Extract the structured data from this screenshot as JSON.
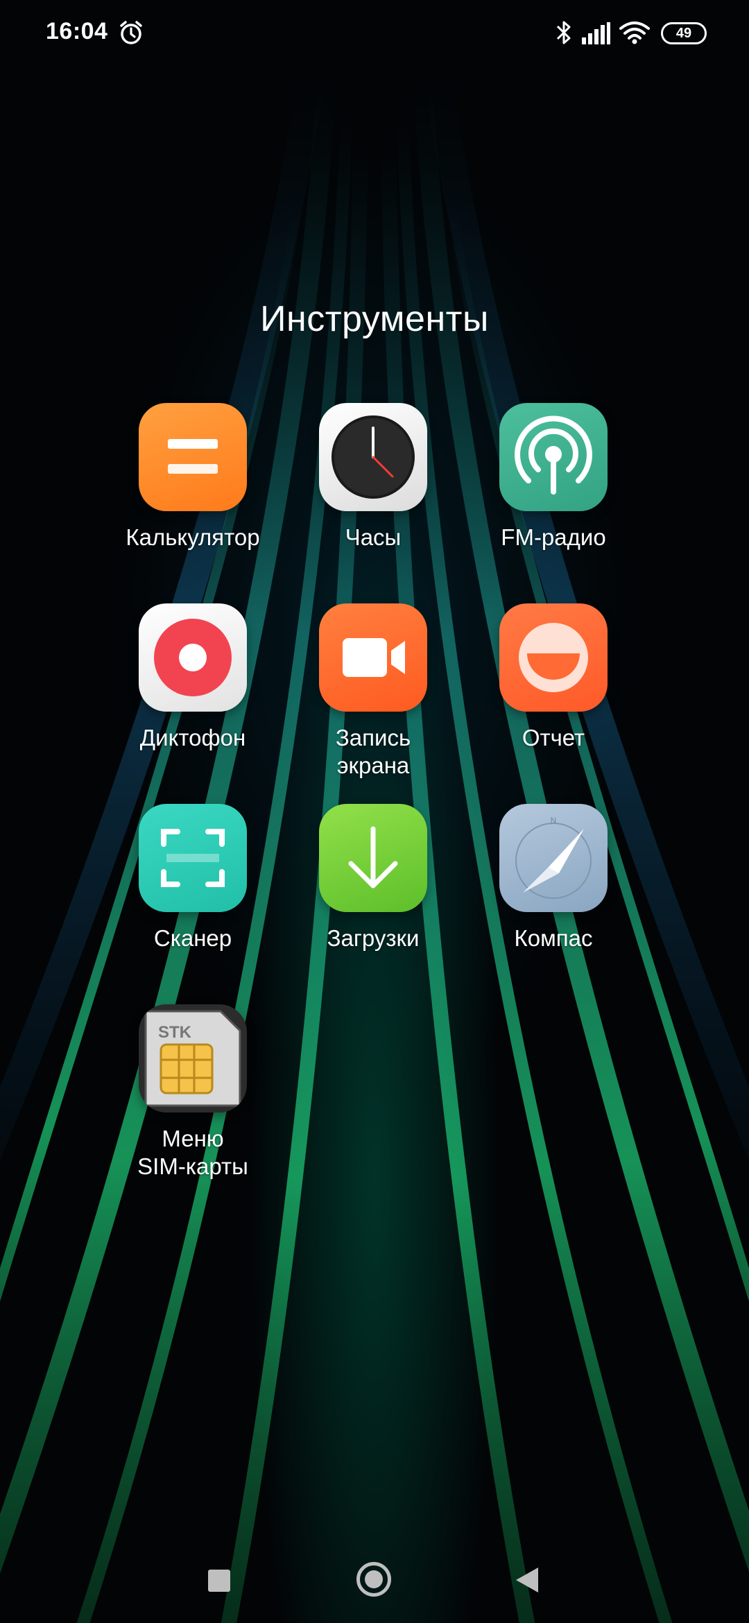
{
  "status_bar": {
    "time": "16:04",
    "battery_level": "49",
    "icons": [
      "alarm-icon",
      "bluetooth-icon",
      "signal-icon",
      "wifi-icon",
      "battery-icon"
    ]
  },
  "folder": {
    "title": "Инструменты",
    "apps": [
      {
        "label": "Калькулятор",
        "icon": "calculator-icon",
        "color": "#FF8A2A"
      },
      {
        "label": "Часы",
        "icon": "clock-icon",
        "color": "#F2F2F2"
      },
      {
        "label": "FM-радио",
        "icon": "radio-icon",
        "color": "#3DAE8C"
      },
      {
        "label": "Диктофон",
        "icon": "recorder-icon",
        "color": "#F0F0F0"
      },
      {
        "label": "Запись\nэкрана",
        "icon": "screen-record-icon",
        "color": "#FF6A2A"
      },
      {
        "label": "Отчет",
        "icon": "feedback-icon",
        "color": "#FF6A35"
      },
      {
        "label": "Сканер",
        "icon": "scanner-icon",
        "color": "#2DCDB8"
      },
      {
        "label": "Загрузки",
        "icon": "download-icon",
        "color": "#7ED33A"
      },
      {
        "label": "Компас",
        "icon": "compass-icon",
        "color": "#9FB6CE"
      },
      {
        "label": "Меню\nSIM-карты",
        "icon": "sim-card-icon",
        "color": "#3A3A3A"
      }
    ]
  },
  "sim_icon_text": "STK",
  "compass_icon_text": "N",
  "nav_bar": {
    "buttons": [
      "recents-button",
      "home-button",
      "back-button"
    ]
  }
}
